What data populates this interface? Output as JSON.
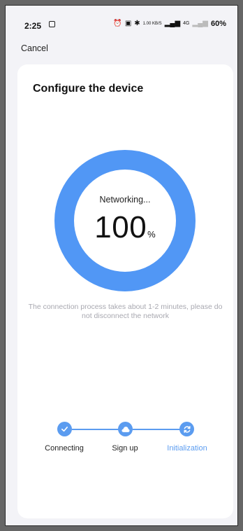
{
  "status_bar": {
    "time": "2:25",
    "network_speed": "1.00 KB/S",
    "network_type": "4G",
    "battery": "60%"
  },
  "header": {
    "cancel_label": "Cancel"
  },
  "card": {
    "title": "Configure the device",
    "progress": {
      "label": "Networking...",
      "value": "100",
      "unit": "%",
      "fraction": 1.0
    },
    "hint": "The connection process takes about 1-2 minutes, please do not disconnect the network",
    "steps": [
      {
        "label": "Connecting",
        "icon": "check-icon",
        "state": "done"
      },
      {
        "label": "Sign up",
        "icon": "cloud-icon",
        "state": "done"
      },
      {
        "label": "Initialization",
        "icon": "sync-icon",
        "state": "active"
      }
    ]
  },
  "colors": {
    "accent": "#5b9cf0",
    "ring": "#5197f5",
    "hint_text": "#a8a8b0",
    "card_bg": "#ffffff",
    "page_bg": "#f3f3f7"
  }
}
